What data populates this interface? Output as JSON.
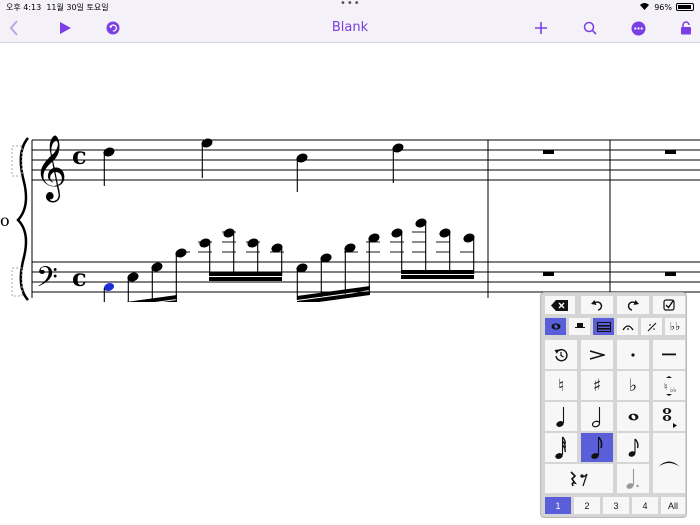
{
  "status": {
    "time": "오후 4:13",
    "date": "11월 30일 토요일",
    "battery": "96%",
    "dots": "•••"
  },
  "nav": {
    "title": "Blank"
  },
  "icons": {
    "back": "chevron-left-icon",
    "play": "play-icon",
    "undo_circle": "undo-circle-icon",
    "add": "plus-icon",
    "search": "search-icon",
    "more": "ellipsis-circle-icon",
    "lock": "lock-icon"
  },
  "score": {
    "clef_treble": "𝄞",
    "clef_bass": "𝄢",
    "time_sig": "c",
    "part_label": "o"
  },
  "palette": {
    "top_row": [
      "delete-icon",
      "undo-icon",
      "redo-icon",
      "checkbox-icon"
    ],
    "mode_row": [
      "whole-note-mode",
      "rest-mode",
      "beam-mode",
      "tie-mode",
      "slash-mode",
      "double-flat-mode"
    ],
    "grid": [
      [
        "time-reset-icon",
        "accent-icon",
        "staccato-icon",
        "tenuto-icon"
      ],
      [
        "natural-icon",
        "sharp-icon",
        "flat-icon",
        "enharmonic-icon"
      ],
      [
        "quarter-note-icon",
        "half-note-icon",
        "whole-note-icon",
        "chord-note-icon"
      ],
      [
        "sixty-fourth-note-icon",
        "eighth-note-icon",
        "eighth-note-small-icon",
        "slur-icon"
      ],
      [
        "rest-combo-icon",
        "dotted-half-icon"
      ]
    ],
    "glyphs": {
      "natural": "♮",
      "sharp": "♯",
      "flat": "♭",
      "dot": "·",
      "tenuto": "—",
      "accent": "›",
      "whole": "𝅝",
      "half": "𝅗𝅥",
      "quarter": "♩",
      "eighth": "♪",
      "double_flat": "♭♭"
    },
    "tabs": [
      "1",
      "2",
      "3",
      "4",
      "All"
    ],
    "selected_tab": "1"
  }
}
